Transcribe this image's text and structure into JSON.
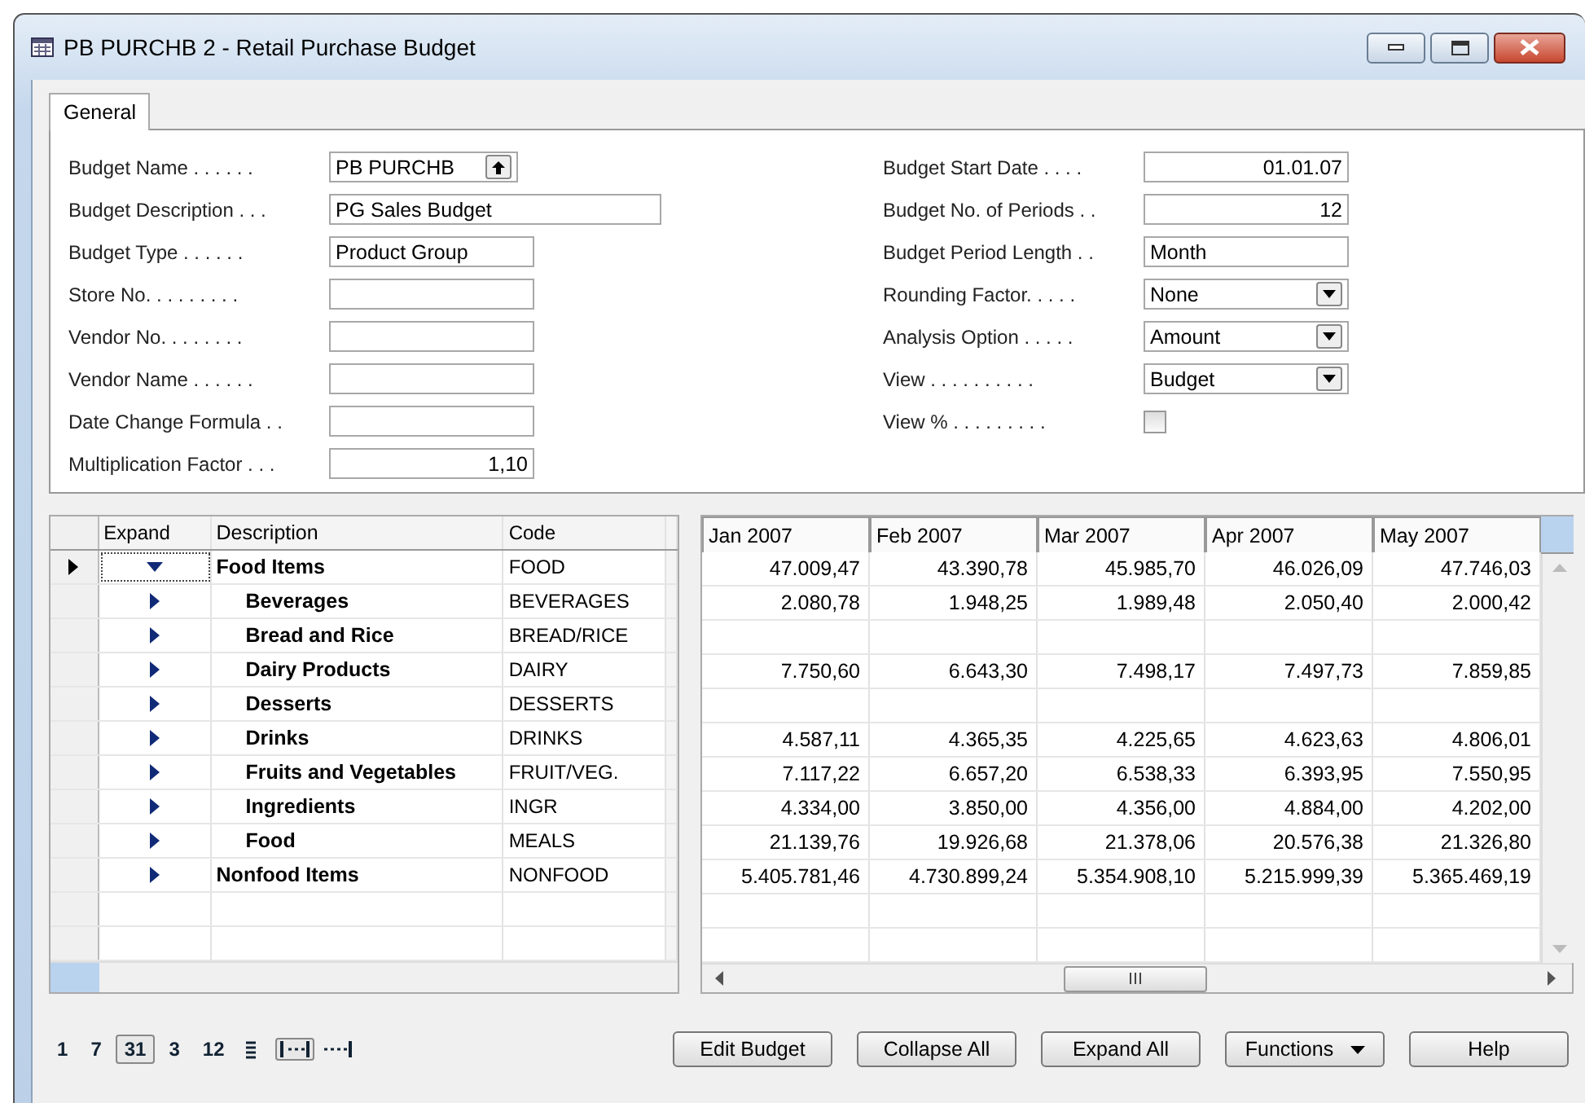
{
  "window": {
    "title": "PB PURCHB 2 - Retail Purchase Budget"
  },
  "tabs": [
    {
      "label": "General",
      "selected": true
    }
  ],
  "form": {
    "left": [
      {
        "label": "Budget Name . . . . . .",
        "kind": "lookup",
        "value": "PB PURCHB"
      },
      {
        "label": "Budget Description . . .",
        "kind": "wide",
        "value": "PG Sales Budget"
      },
      {
        "label": "Budget Type . . . . . .",
        "kind": "text",
        "value": "Product Group"
      },
      {
        "label": "Store No. . . . . . . . .",
        "kind": "text"
      },
      {
        "label": "Vendor No. . . . . . . .",
        "kind": "text"
      },
      {
        "label": "Vendor Name . . . . . .",
        "kind": "text"
      },
      {
        "label": "Date Change Formula . .",
        "kind": "text"
      },
      {
        "label": "Multiplication Factor . . .",
        "kind": "number",
        "value": "1,10"
      }
    ],
    "right": [
      {
        "label": "Budget Start Date . . . .",
        "kind": "number",
        "value": "01.01.07"
      },
      {
        "label": "Budget No. of Periods . .",
        "kind": "number",
        "value": "12"
      },
      {
        "label": "Budget Period Length . .",
        "kind": "text",
        "value": "Month"
      },
      {
        "label": "Rounding Factor. . . . .",
        "kind": "dropdown",
        "value": "None"
      },
      {
        "label": "Analysis Option . . . . .",
        "kind": "dropdown",
        "value": "Amount"
      },
      {
        "label": "View . . . . . . . . . .",
        "kind": "dropdown",
        "value": "Budget"
      },
      {
        "label": "View % . . . . . . . . .",
        "kind": "checkbox",
        "checked": false
      }
    ]
  },
  "grid": {
    "columns": [
      "Expand",
      "Description",
      "Code"
    ],
    "periods": [
      "Jan 2007",
      "Feb 2007",
      "Mar 2007",
      "Apr 2007",
      "May 2007"
    ],
    "rows": [
      {
        "description": "Food Items",
        "code": "FOOD",
        "expanded": true,
        "selected": true,
        "values": [
          "47.009,47",
          "43.390,78",
          "45.985,70",
          "46.026,09",
          "47.746,03"
        ],
        "children": [
          {
            "description": "Beverages",
            "code": "BEVERAGES",
            "expanded": false,
            "selected": false,
            "values": [
              "2.080,78",
              "1.948,25",
              "1.989,48",
              "2.050,40",
              "2.000,42"
            ]
          },
          {
            "description": "Bread and Rice",
            "code": "BREAD/RICE",
            "expanded": false,
            "selected": false
          },
          {
            "description": "Dairy Products",
            "code": "DAIRY",
            "expanded": false,
            "selected": false,
            "values": [
              "7.750,60",
              "6.643,30",
              "7.498,17",
              "7.497,73",
              "7.859,85"
            ]
          },
          {
            "description": "Desserts",
            "code": "DESSERTS",
            "expanded": false,
            "selected": false
          },
          {
            "description": "Drinks",
            "code": "DRINKS",
            "expanded": false,
            "selected": false,
            "values": [
              "4.587,11",
              "4.365,35",
              "4.225,65",
              "4.623,63",
              "4.806,01"
            ]
          },
          {
            "description": "Fruits and Vegetables",
            "code": "FRUIT/VEG.",
            "expanded": false,
            "selected": false,
            "values": [
              "7.117,22",
              "6.657,20",
              "6.538,33",
              "6.393,95",
              "7.550,95"
            ]
          },
          {
            "description": "Ingredients",
            "code": "INGR",
            "expanded": false,
            "selected": false,
            "values": [
              "4.334,00",
              "3.850,00",
              "4.356,00",
              "4.884,00",
              "4.202,00"
            ]
          },
          {
            "description": "Food",
            "code": "MEALS",
            "expanded": false,
            "selected": false,
            "values": [
              "21.139,76",
              "19.926,68",
              "21.378,06",
              "20.576,38",
              "21.326,80"
            ]
          }
        ]
      },
      {
        "description": "Nonfood Items",
        "code": "NONFOOD",
        "expanded": false,
        "selected": false,
        "values": [
          "5.405.781,46",
          "4.730.899,24",
          "5.354.908,10",
          "5.215.999,39",
          "5.365.469,19"
        ]
      }
    ]
  },
  "period_buttons": [
    {
      "label": "1",
      "selected": false
    },
    {
      "label": "7",
      "selected": false
    },
    {
      "label": "31",
      "selected": true
    },
    {
      "label": "3",
      "selected": false
    },
    {
      "label": "12",
      "selected": false
    }
  ],
  "range_modes": [
    {
      "kind": "period",
      "selected": true
    },
    {
      "kind": "to-date",
      "selected": false
    }
  ],
  "buttons": [
    {
      "label": "Edit Budget",
      "kind": "plain"
    },
    {
      "label": "Collapse All",
      "kind": "plain"
    },
    {
      "label": "Expand All",
      "kind": "plain"
    },
    {
      "label": "Functions",
      "kind": "menu"
    },
    {
      "label": "Help",
      "kind": "plain"
    }
  ]
}
